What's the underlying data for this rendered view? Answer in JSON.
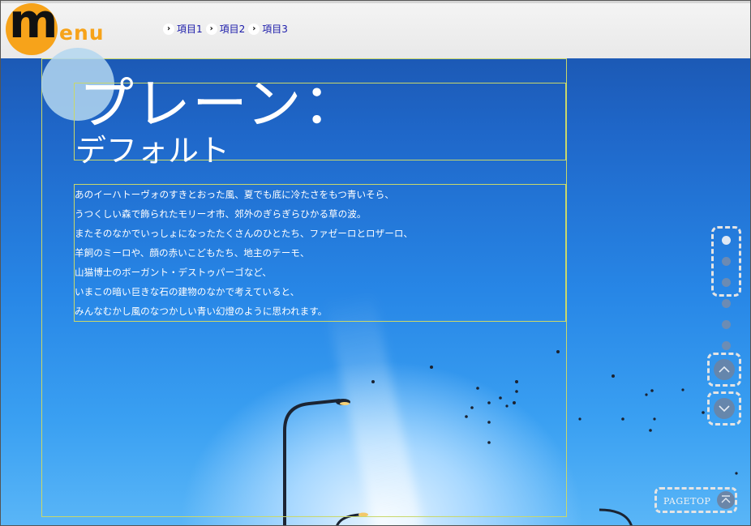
{
  "header": {
    "logo": {
      "letter": "m",
      "rest": "enu",
      "accent_color": "#f7a31a"
    },
    "breadcrumb": [
      {
        "label": "項目1"
      },
      {
        "label": "項目2"
      },
      {
        "label": "項目3"
      }
    ]
  },
  "main": {
    "title_line1": "プレーン：",
    "title_line2": "デフォルト",
    "body_lines": [
      "あのイーハトーヴォのすきとおった風、夏でも底に冷たさをもつ青いそら、",
      "うつくしい森で飾られたモリーオ市、郊外のぎらぎらひかる草の波。",
      "またそのなかでいっしょになったたくさんのひとたち、ファゼーロとロザーロ、",
      "羊飼のミーロや、顔の赤いこどもたち、地主のテーモ、",
      "山猫博士のボーガント・デストゥパーゴなど、",
      "いまこの暗い巨きな石の建物のなかで考えていると、",
      "みんなむかし風のなつかしい青い幻燈のように思われます。"
    ]
  },
  "side_nav": {
    "dot_count": 6,
    "active_index": 0,
    "up_icon": "chevron-up-icon",
    "down_icon": "chevron-down-icon"
  },
  "pagetop": {
    "label": "PAGETOP",
    "icon": "arrow-to-top-icon"
  }
}
